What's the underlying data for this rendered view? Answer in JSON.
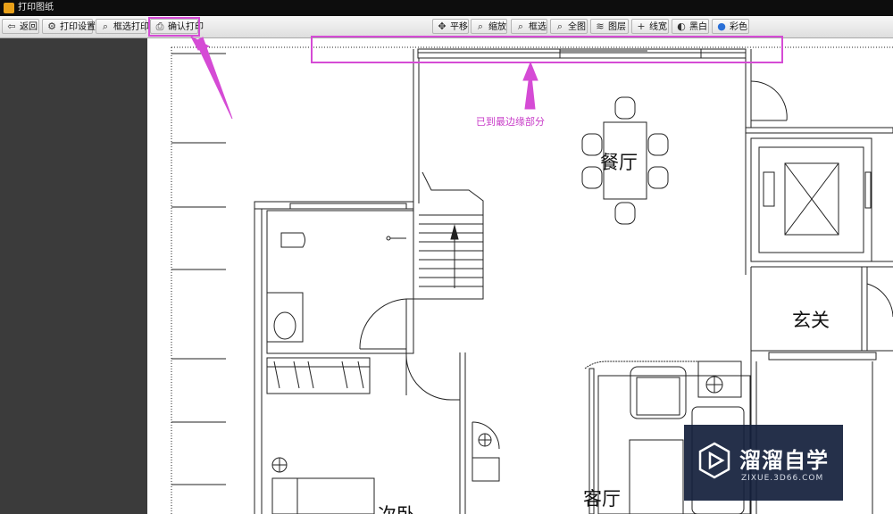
{
  "window": {
    "title": "打印图纸"
  },
  "toolbar": {
    "left": [
      {
        "name": "back-button",
        "icon": "back-arrow-icon",
        "glyph": "⇦",
        "label": "返回"
      },
      {
        "name": "print-settings-button",
        "icon": "settings-icon",
        "glyph": "⚙",
        "label": "打印设置"
      },
      {
        "name": "frame-print-button",
        "icon": "magnifier-icon",
        "glyph": "⌕",
        "label": "框选打印"
      },
      {
        "name": "confirm-print-button",
        "icon": "printer-icon",
        "glyph": "⎙",
        "label": "确认打印"
      }
    ],
    "right": [
      {
        "name": "pan-button",
        "icon": "pan-icon",
        "glyph": "✥",
        "label": "平移"
      },
      {
        "name": "zoom-button",
        "icon": "zoom-icon",
        "glyph": "⌕",
        "label": "缩放"
      },
      {
        "name": "frame-select-button",
        "icon": "frame-select-icon",
        "glyph": "⌕",
        "label": "框选"
      },
      {
        "name": "full-view-button",
        "icon": "full-view-icon",
        "glyph": "⌕",
        "label": "全图"
      },
      {
        "name": "layers-button",
        "icon": "layers-icon",
        "glyph": "≋",
        "label": "图层"
      },
      {
        "name": "line-width-button",
        "icon": "plus-icon",
        "glyph": "+",
        "label": "线宽"
      },
      {
        "name": "black-white-button",
        "icon": "palette-icon",
        "glyph": "◐",
        "label": "黑白"
      },
      {
        "name": "color-button",
        "icon": "color-icon",
        "glyph": "●",
        "label": "彩色"
      }
    ]
  },
  "drawing": {
    "rooms": {
      "dining": "餐厅",
      "entrance": "玄关",
      "living": "客厅",
      "bedroom": "次卧"
    }
  },
  "annotations": {
    "edge_note": "已到最边缘部分"
  },
  "watermark": {
    "name": "溜溜自学",
    "url": "ZIXUE.3D66.COM"
  },
  "colors": {
    "annotation": "#d54bd5",
    "toolbar": "#e8e8e8",
    "panel": "#3b3b3b"
  }
}
